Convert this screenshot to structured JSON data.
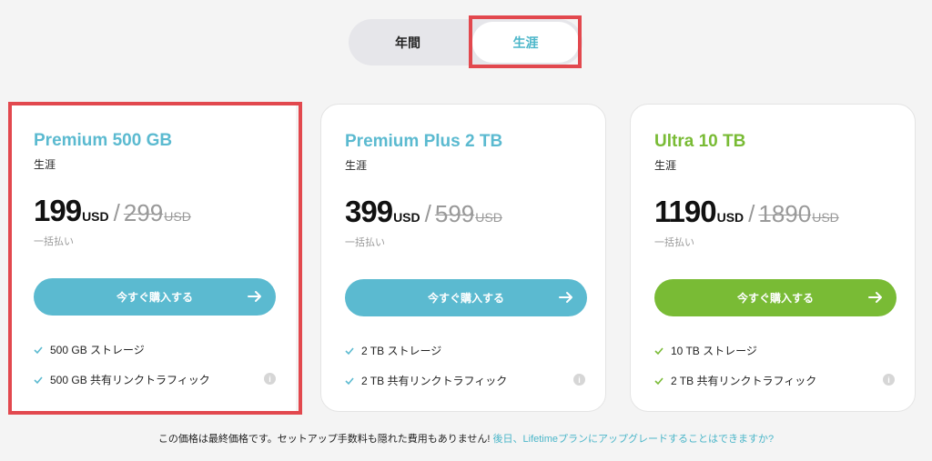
{
  "toggle": {
    "annual_label": "年間",
    "lifetime_label": "生涯"
  },
  "colors": {
    "teal": "#5bbad0",
    "teal_text": "#4bb6c9",
    "green": "#79bb35",
    "highlight": "#e2484e"
  },
  "plans": [
    {
      "name": "Premium 500 GB",
      "subtitle": "生涯",
      "price": "199",
      "currency": "USD",
      "slash": "/",
      "old_price": "299",
      "old_currency": "USD",
      "payment_note": "一括払い",
      "button_label": "今すぐ購入する",
      "features": [
        "500 GB ストレージ",
        "500 GB 共有リンクトラフィック"
      ],
      "info_icon": "i"
    },
    {
      "name": "Premium Plus 2 TB",
      "subtitle": "生涯",
      "price": "399",
      "currency": "USD",
      "slash": "/",
      "old_price": "599",
      "old_currency": "USD",
      "payment_note": "一括払い",
      "button_label": "今すぐ購入する",
      "features": [
        "2 TB ストレージ",
        "2 TB 共有リンクトラフィック"
      ],
      "info_icon": "i"
    },
    {
      "name": "Ultra 10 TB",
      "subtitle": "生涯",
      "price": "1190",
      "currency": "USD",
      "slash": "/",
      "old_price": "1890",
      "old_currency": "USD",
      "payment_note": "一括払い",
      "button_label": "今すぐ購入する",
      "features": [
        "10 TB ストレージ",
        "2 TB 共有リンクトラフィック"
      ],
      "info_icon": "i"
    }
  ],
  "footer": {
    "text": "この価格は最終価格です。セットアップ手数料も隠れた費用もありません!",
    "link": "後日、Lifetimeプランにアップグレードすることはできますか?"
  }
}
